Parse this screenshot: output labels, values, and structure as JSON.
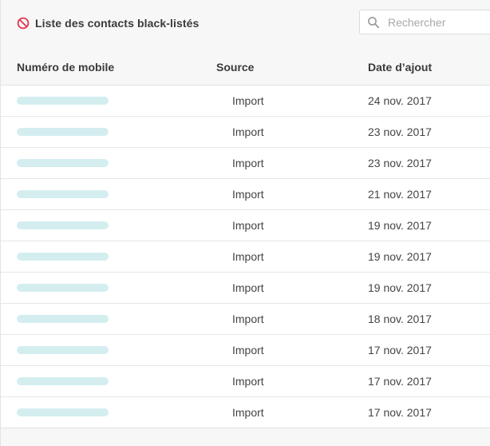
{
  "header": {
    "title": "Liste des contacts black-listés",
    "title_icon": "ban-icon",
    "search_placeholder": "Rechercher",
    "search_value": ""
  },
  "colors": {
    "ban_icon": "#e0344b",
    "masked_number": "#d4eef0",
    "header_bg": "#f7f7f7"
  },
  "table": {
    "columns": [
      "Numéro de mobile",
      "Source",
      "Date d’ajout"
    ],
    "rows": [
      {
        "source": "Import",
        "date": "24 nov. 2017"
      },
      {
        "source": "Import",
        "date": "23 nov. 2017"
      },
      {
        "source": "Import",
        "date": "23 nov. 2017"
      },
      {
        "source": "Import",
        "date": "21 nov. 2017"
      },
      {
        "source": "Import",
        "date": "19 nov. 2017"
      },
      {
        "source": "Import",
        "date": "19 nov. 2017"
      },
      {
        "source": "Import",
        "date": "19 nov. 2017"
      },
      {
        "source": "Import",
        "date": "18 nov. 2017"
      },
      {
        "source": "Import",
        "date": "17 nov. 2017"
      },
      {
        "source": "Import",
        "date": "17 nov. 2017"
      },
      {
        "source": "Import",
        "date": "17 nov. 2017"
      }
    ]
  }
}
